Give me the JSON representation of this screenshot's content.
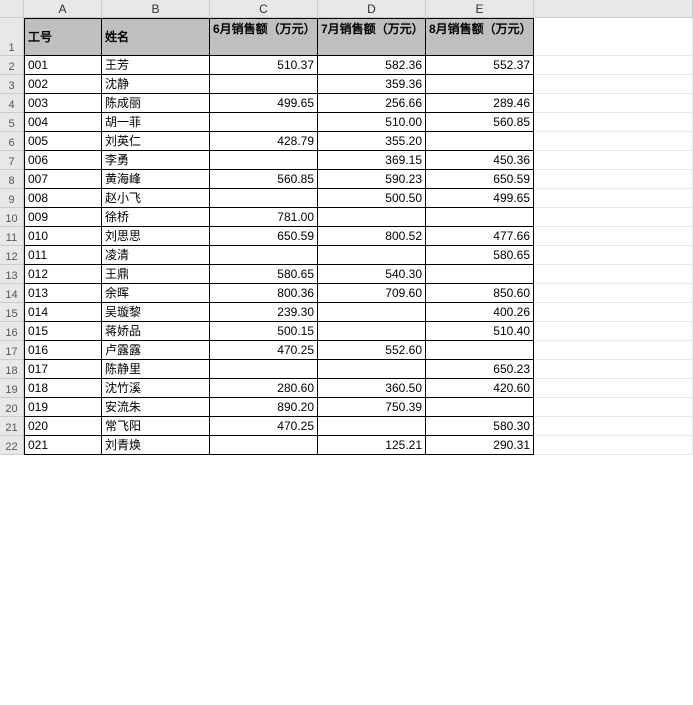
{
  "columns": [
    "A",
    "B",
    "C",
    "D",
    "E"
  ],
  "headers": {
    "a": "工号",
    "b": "姓名",
    "c": "6月销售额（万元）",
    "d": "7月销售额（万元）",
    "e": "8月销售额（万元）"
  },
  "rows": [
    {
      "n": "1"
    },
    {
      "n": "2",
      "a": "001",
      "b": "王芳",
      "c": "510.37",
      "d": "582.36",
      "e": "552.37"
    },
    {
      "n": "3",
      "a": "002",
      "b": "沈静",
      "c": "",
      "d": "359.36",
      "e": ""
    },
    {
      "n": "4",
      "a": "003",
      "b": "陈成丽",
      "c": "499.65",
      "d": "256.66",
      "e": "289.46"
    },
    {
      "n": "5",
      "a": "004",
      "b": "胡一菲",
      "c": "",
      "d": "510.00",
      "e": "560.85"
    },
    {
      "n": "6",
      "a": "005",
      "b": "刘英仁",
      "c": "428.79",
      "d": "355.20",
      "e": ""
    },
    {
      "n": "7",
      "a": "006",
      "b": "李勇",
      "c": "",
      "d": "369.15",
      "e": "450.36"
    },
    {
      "n": "8",
      "a": "007",
      "b": "黄海峰",
      "c": "560.85",
      "d": "590.23",
      "e": "650.59"
    },
    {
      "n": "9",
      "a": "008",
      "b": "赵小飞",
      "c": "",
      "d": "500.50",
      "e": "499.65"
    },
    {
      "n": "10",
      "a": "009",
      "b": "徐桥",
      "c": "781.00",
      "d": "",
      "e": ""
    },
    {
      "n": "11",
      "a": "010",
      "b": "刘思思",
      "c": "650.59",
      "d": "800.52",
      "e": "477.66"
    },
    {
      "n": "12",
      "a": "011",
      "b": "凌清",
      "c": "",
      "d": "",
      "e": "580.65"
    },
    {
      "n": "13",
      "a": "012",
      "b": "王鼎",
      "c": "580.65",
      "d": "540.30",
      "e": ""
    },
    {
      "n": "14",
      "a": "013",
      "b": "余晖",
      "c": "800.36",
      "d": "709.60",
      "e": "850.60"
    },
    {
      "n": "15",
      "a": "014",
      "b": "吴璇黎",
      "c": "239.30",
      "d": "",
      "e": "400.26"
    },
    {
      "n": "16",
      "a": "015",
      "b": "蒋娇品",
      "c": "500.15",
      "d": "",
      "e": "510.40"
    },
    {
      "n": "17",
      "a": "016",
      "b": "卢露露",
      "c": "470.25",
      "d": "552.60",
      "e": ""
    },
    {
      "n": "18",
      "a": "017",
      "b": "陈静里",
      "c": "",
      "d": "",
      "e": "650.23"
    },
    {
      "n": "19",
      "a": "018",
      "b": "沈竹溪",
      "c": "280.60",
      "d": "360.50",
      "e": "420.60"
    },
    {
      "n": "20",
      "a": "019",
      "b": "安流朱",
      "c": "890.20",
      "d": "750.39",
      "e": ""
    },
    {
      "n": "21",
      "a": "020",
      "b": "常飞阳",
      "c": "470.25",
      "d": "",
      "e": "580.30"
    },
    {
      "n": "22",
      "a": "021",
      "b": "刘青焕",
      "c": "",
      "d": "125.21",
      "e": "290.31"
    }
  ],
  "chart_data": {
    "type": "table",
    "title": "销售额",
    "columns": [
      "工号",
      "姓名",
      "6月销售额（万元）",
      "7月销售额（万元）",
      "8月销售额（万元）"
    ],
    "data": [
      [
        "001",
        "王芳",
        510.37,
        582.36,
        552.37
      ],
      [
        "002",
        "沈静",
        null,
        359.36,
        null
      ],
      [
        "003",
        "陈成丽",
        499.65,
        256.66,
        289.46
      ],
      [
        "004",
        "胡一菲",
        null,
        510.0,
        560.85
      ],
      [
        "005",
        "刘英仁",
        428.79,
        355.2,
        null
      ],
      [
        "006",
        "李勇",
        null,
        369.15,
        450.36
      ],
      [
        "007",
        "黄海峰",
        560.85,
        590.23,
        650.59
      ],
      [
        "008",
        "赵小飞",
        null,
        500.5,
        499.65
      ],
      [
        "009",
        "徐桥",
        781.0,
        null,
        null
      ],
      [
        "010",
        "刘思思",
        650.59,
        800.52,
        477.66
      ],
      [
        "011",
        "凌清",
        null,
        null,
        580.65
      ],
      [
        "012",
        "王鼎",
        580.65,
        540.3,
        null
      ],
      [
        "013",
        "余晖",
        800.36,
        709.6,
        850.6
      ],
      [
        "014",
        "吴璇黎",
        239.3,
        null,
        400.26
      ],
      [
        "015",
        "蒋娇品",
        500.15,
        null,
        510.4
      ],
      [
        "016",
        "卢露露",
        470.25,
        552.6,
        null
      ],
      [
        "017",
        "陈静里",
        null,
        null,
        650.23
      ],
      [
        "018",
        "沈竹溪",
        280.6,
        360.5,
        420.6
      ],
      [
        "019",
        "安流朱",
        890.2,
        750.39,
        null
      ],
      [
        "020",
        "常飞阳",
        470.25,
        null,
        580.3
      ],
      [
        "021",
        "刘青焕",
        null,
        125.21,
        290.31
      ]
    ]
  }
}
